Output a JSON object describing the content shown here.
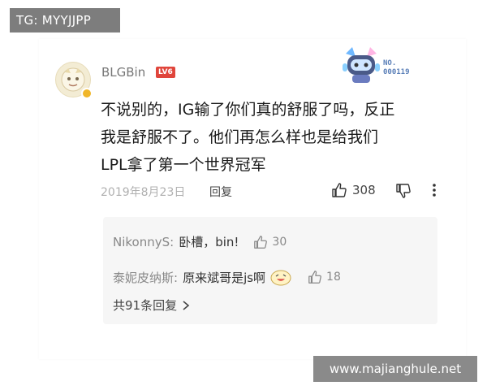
{
  "tag": "TG: MYYJJPP",
  "comment": {
    "username": "BLGBin",
    "level": "LV6",
    "badge_number_line1": "NO.",
    "badge_number_line2": "000119",
    "text_line1": "不说别的，IG输了你们真的舒服了吗，反正",
    "text_line2": "我是舒服不了。他们再怎么样也是给我们",
    "text_line3": "LPL拿了第一个世界冠军",
    "date": "2019年8月23日",
    "reply_label": "回复",
    "like_count": "308"
  },
  "replies": [
    {
      "author": "NikonnyS:",
      "text": "卧槽，bin!",
      "likes": "30"
    },
    {
      "author": "泰妮皮纳斯:",
      "text": "原来斌哥是js啊",
      "likes": "18"
    }
  ],
  "view_all": "共91条回复",
  "watermark": "www.majianghule.net",
  "colors": {
    "accent_red": "#e0453b",
    "mascot_blue": "#5a7fb8"
  },
  "icons": [
    "avatar-badge-icon",
    "mascot-icon",
    "thumbs-up-icon",
    "thumbs-down-icon",
    "more-icon",
    "laugh-emoji-icon",
    "chevron-right-icon"
  ]
}
